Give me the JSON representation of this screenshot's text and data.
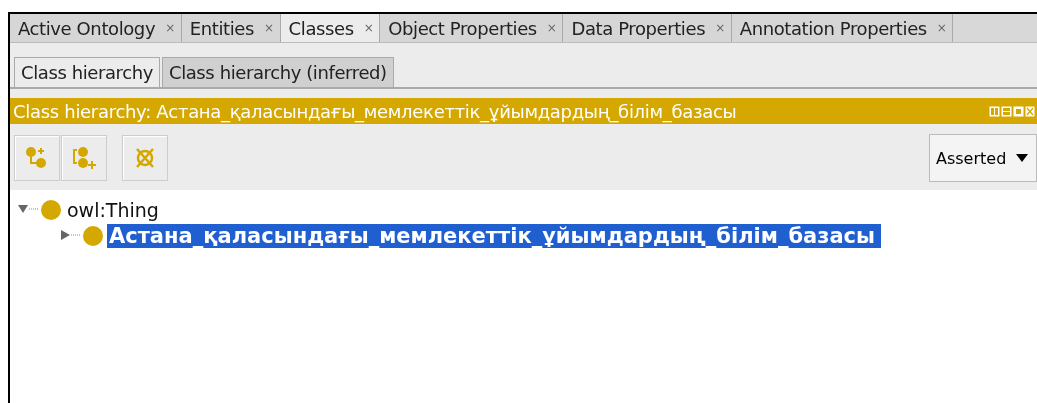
{
  "tabs": [
    {
      "label": "Active Ontology",
      "close": "×",
      "selected": false
    },
    {
      "label": "Entities",
      "close": "×",
      "selected": false
    },
    {
      "label": "Classes",
      "close": "×",
      "selected": true
    },
    {
      "label": "Object Properties",
      "close": "×",
      "selected": false
    },
    {
      "label": "Data Properties",
      "close": "×",
      "selected": false
    },
    {
      "label": "Annotation Properties",
      "close": "×",
      "selected": false
    }
  ],
  "subtabs": [
    {
      "label": "Class hierarchy",
      "selected": true
    },
    {
      "label": "Class hierarchy (inferred)",
      "selected": false
    }
  ],
  "view_title": "Class hierarchy: Астана_қаласындағы_мемлекеттік_ұйымдардың_білім_базасы",
  "mode_select": {
    "value": "Asserted"
  },
  "tree": [
    {
      "label": "owl:Thing",
      "expanded": true,
      "selected": false,
      "children": [
        {
          "label": "Астана_қаласындағы_мемлекеттік_ұйымдардың_білім_базасы",
          "expanded": false,
          "selected": true
        }
      ]
    }
  ]
}
